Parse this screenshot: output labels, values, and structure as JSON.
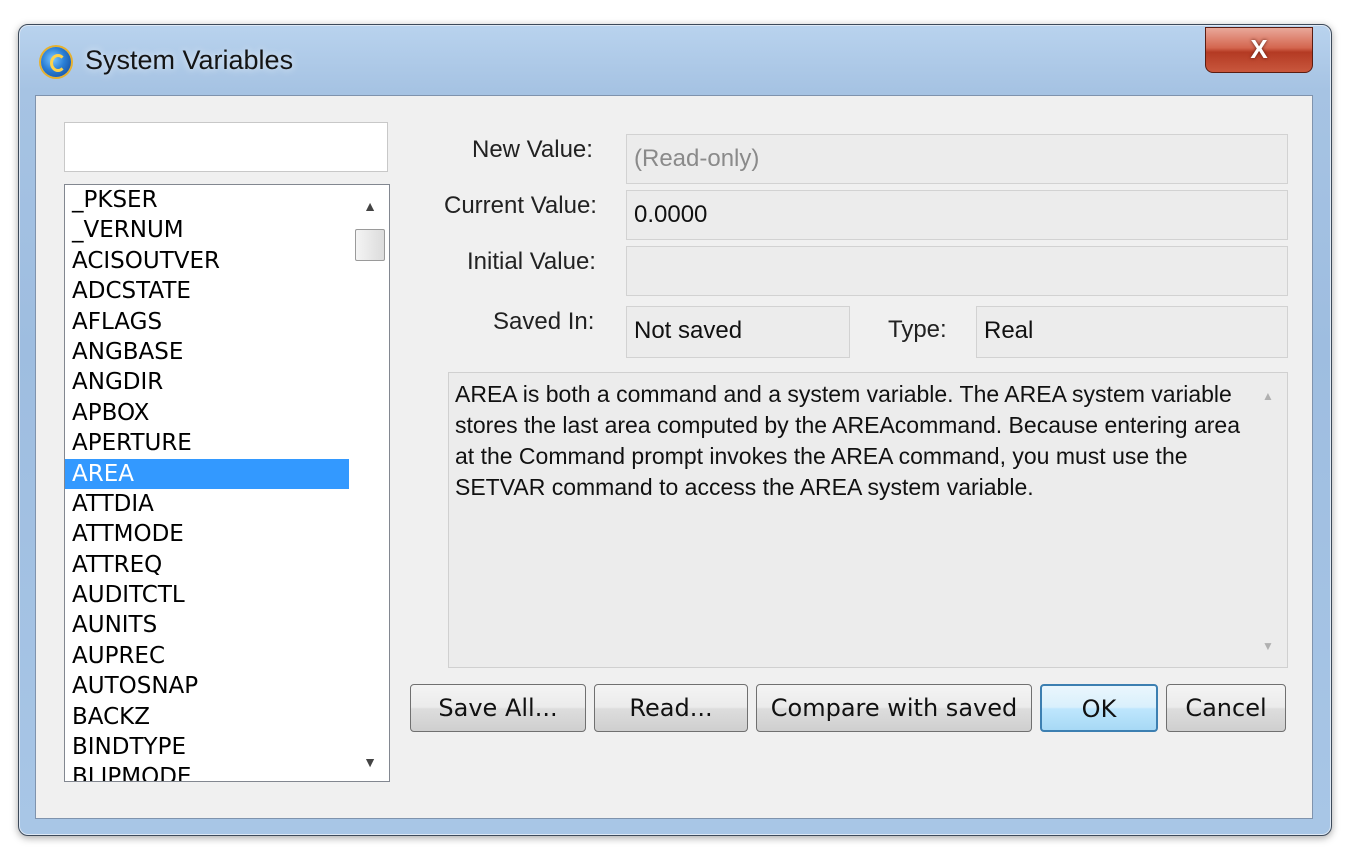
{
  "window": {
    "title": "System Variables",
    "close_label": "X"
  },
  "search": {
    "value": ""
  },
  "variable_list": {
    "items": [
      "_PKSER",
      "_VERNUM",
      "ACISOUTVER",
      "ADCSTATE",
      "AFLAGS",
      "ANGBASE",
      "ANGDIR",
      "APBOX",
      "APERTURE",
      "AREA",
      "ATTDIA",
      "ATTMODE",
      "ATTREQ",
      "AUDITCTL",
      "AUNITS",
      "AUPREC",
      "AUTOSNAP",
      "BACKZ",
      "BINDTYPE",
      "BLIPMODE"
    ],
    "selected": "AREA"
  },
  "fields": {
    "new_value_label": "New Value:",
    "new_value": "(Read-only)",
    "current_value_label": "Current Value:",
    "current_value": "0.0000",
    "initial_value_label": "Initial Value:",
    "initial_value": "",
    "saved_in_label": "Saved In:",
    "saved_in": "Not saved",
    "type_label": "Type:",
    "type": "Real"
  },
  "description": "AREA is both a command and a system variable. The AREA system variable stores the last area computed by the AREAcommand. Because entering area at the Command prompt invokes the AREA command, you must use the SETVAR command to access the AREA system variable.",
  "buttons": {
    "save_all": "Save All...",
    "read": "Read...",
    "compare": "Compare with saved",
    "ok": "OK",
    "cancel": "Cancel"
  }
}
